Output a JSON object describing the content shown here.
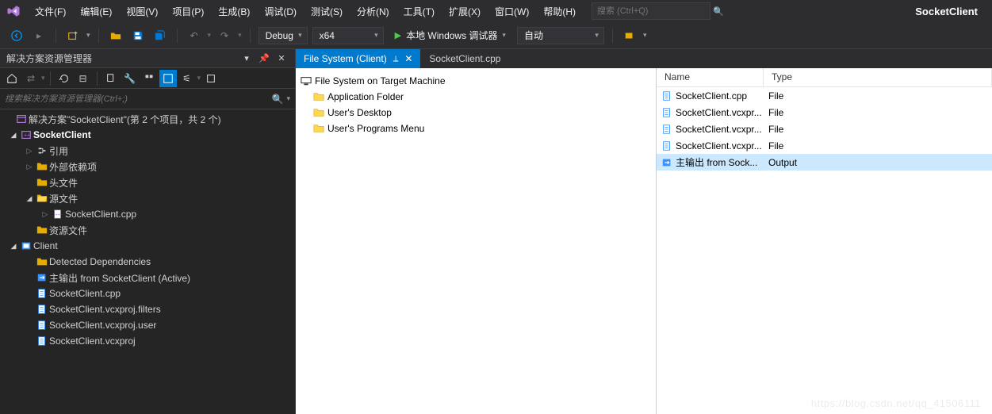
{
  "menubar": {
    "items": [
      "文件(F)",
      "编辑(E)",
      "视图(V)",
      "项目(P)",
      "生成(B)",
      "调试(D)",
      "测试(S)",
      "分析(N)",
      "工具(T)",
      "扩展(X)",
      "窗口(W)",
      "帮助(H)"
    ],
    "search_placeholder": "搜索 (Ctrl+Q)",
    "solution_name": "SocketClient"
  },
  "toolbar": {
    "config": "Debug",
    "platform": "x64",
    "start_label": "本地 Windows 调试器",
    "extra": "自动"
  },
  "solution_explorer": {
    "title": "解决方案资源管理器",
    "search_placeholder": "搜索解决方案资源管理器(Ctrl+;)",
    "solution_line": "解决方案\"SocketClient\"(第 2 个项目，共 2 个)",
    "proj1": "SocketClient",
    "proj1_refs": "引用",
    "proj1_ext": "外部依赖项",
    "proj1_hdr": "头文件",
    "proj1_src": "源文件",
    "proj1_src_file": "SocketClient.cpp",
    "proj1_res": "资源文件",
    "proj2": "Client",
    "proj2_deps": "Detected Dependencies",
    "proj2_out": "主输出 from SocketClient (Active)",
    "proj2_f1": "SocketClient.cpp",
    "proj2_f2": "SocketClient.vcxproj.filters",
    "proj2_f3": "SocketClient.vcxproj.user",
    "proj2_f4": "SocketClient.vcxproj"
  },
  "tabs": {
    "active": "File System (Client)",
    "inactive": "SocketClient.cpp"
  },
  "fs": {
    "root": "File System on Target Machine",
    "app": "Application Folder",
    "desktop": "User's Desktop",
    "menu": "User's Programs Menu"
  },
  "details": {
    "col_name": "Name",
    "col_type": "Type",
    "rows": [
      {
        "name": "SocketClient.cpp",
        "type": "File"
      },
      {
        "name": "SocketClient.vcxpr...",
        "type": "File"
      },
      {
        "name": "SocketClient.vcxpr...",
        "type": "File"
      },
      {
        "name": "SocketClient.vcxpr...",
        "type": "File"
      },
      {
        "name": "主输出 from Sock...",
        "type": "Output"
      }
    ]
  },
  "watermark": "https://blog.csdn.net/qq_41506111"
}
